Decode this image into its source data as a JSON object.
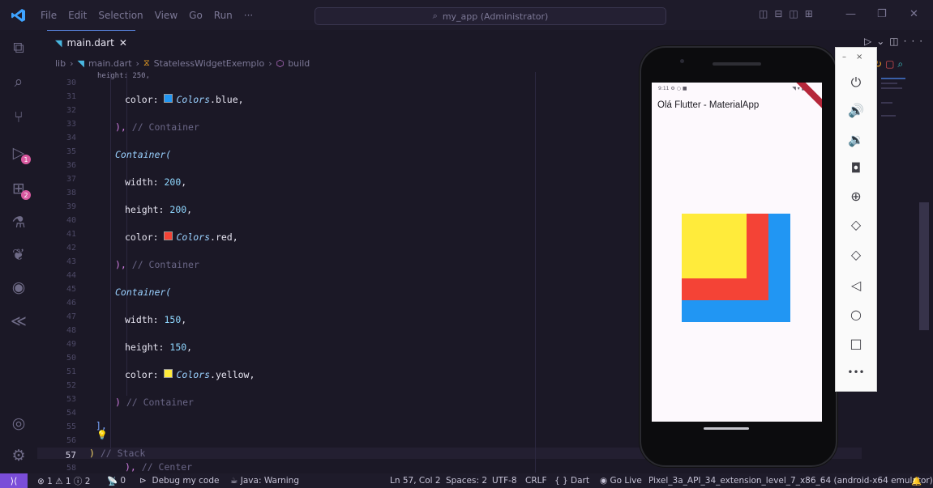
{
  "titlebar": {
    "menu": [
      "File",
      "Edit",
      "Selection",
      "View",
      "Go",
      "Run",
      "···"
    ],
    "command_center": "my_app (Administrator)"
  },
  "activity_bar": {
    "run_badge": "1",
    "extensions_badge": "2"
  },
  "editor": {
    "tab_label": "main.dart",
    "tab_close": "✕",
    "breadcrumb": [
      "lib",
      "main.dart",
      "StatelessWidgetExemplo",
      "build"
    ],
    "lines": [
      {
        "n": "30",
        "text": "height: 250,"
      },
      {
        "n": "31"
      },
      {
        "n": "32"
      },
      {
        "n": "33"
      },
      {
        "n": "34"
      },
      {
        "n": "35"
      },
      {
        "n": "36"
      },
      {
        "n": "37"
      },
      {
        "n": "38"
      },
      {
        "n": "39"
      },
      {
        "n": "40"
      },
      {
        "n": "41"
      },
      {
        "n": "42"
      },
      {
        "n": "43"
      },
      {
        "n": "44"
      },
      {
        "n": "45"
      },
      {
        "n": "46"
      },
      {
        "n": "47"
      },
      {
        "n": "48"
      },
      {
        "n": "49"
      },
      {
        "n": "50"
      },
      {
        "n": "51"
      },
      {
        "n": "52"
      },
      {
        "n": "53"
      },
      {
        "n": "54"
      },
      {
        "n": "55"
      },
      {
        "n": "56"
      },
      {
        "n": "57"
      },
      {
        "n": "58"
      }
    ],
    "code": {
      "l31_prop": "color: ",
      "l31_val": "Colors",
      "l31_rest": ".blue,",
      "l33_close": "),",
      "l33_cmt": " // Container",
      "l35": "Container(",
      "l37_prop": "width: ",
      "l37_num": "200",
      "l37_end": ",",
      "l39_prop": "height: ",
      "l39_num": "200",
      "l39_end": ",",
      "l41_prop": "color: ",
      "l41_val": "Colors",
      "l41_rest": ".red,",
      "l43_close": "),",
      "l43_cmt": " // Container",
      "l45": "Container(",
      "l47_prop": "width: ",
      "l47_num": "150",
      "l47_end": ",",
      "l49_prop": "height: ",
      "l49_num": "150",
      "l49_end": ",",
      "l51_prop": "color: ",
      "l51_val": "Colors",
      "l51_rest": ".yellow,",
      "l53_close": ")",
      "l53_cmt": " // Container",
      "l55": "],",
      "l57_close": ")",
      "l57_cmt": " // Stack",
      "l58_close": "),",
      "l58_cmt": " // Center"
    },
    "swatch_colors": {
      "blue": "#2196f3",
      "red": "#f44336",
      "yellow": "#ffeb3b"
    }
  },
  "statusbar": {
    "problems": "⊗ 1 ⚠ 1 ⓘ 2",
    "ports": "0",
    "debug": "Debug my code",
    "java": "Java: Warning",
    "position": "Ln 57, Col 2",
    "spaces": "Spaces: 2",
    "encoding": "UTF-8",
    "eol": "CRLF",
    "language": "{ } Dart",
    "golive": "Go Live",
    "device": "Pixel_3a_API_34_extension_level_7_x86_64 (android-x64 emulator)"
  },
  "phone": {
    "status_time": "9:11",
    "app_title": "Olá Flutter - MaterialApp",
    "squares": [
      {
        "name": "blue",
        "size": 250,
        "color": "#2196f3"
      },
      {
        "name": "red",
        "size": 200,
        "color": "#f44336"
      },
      {
        "name": "yellow",
        "size": 150,
        "color": "#ffeb3b"
      }
    ]
  },
  "emulator_panel": {
    "buttons": [
      "power-icon",
      "volume-up-icon",
      "volume-down-icon",
      "camera-icon",
      "zoom-icon",
      "rotate-left-icon",
      "rotate-right-icon",
      "back-icon",
      "home-icon",
      "overview-icon",
      "more-icon"
    ]
  }
}
